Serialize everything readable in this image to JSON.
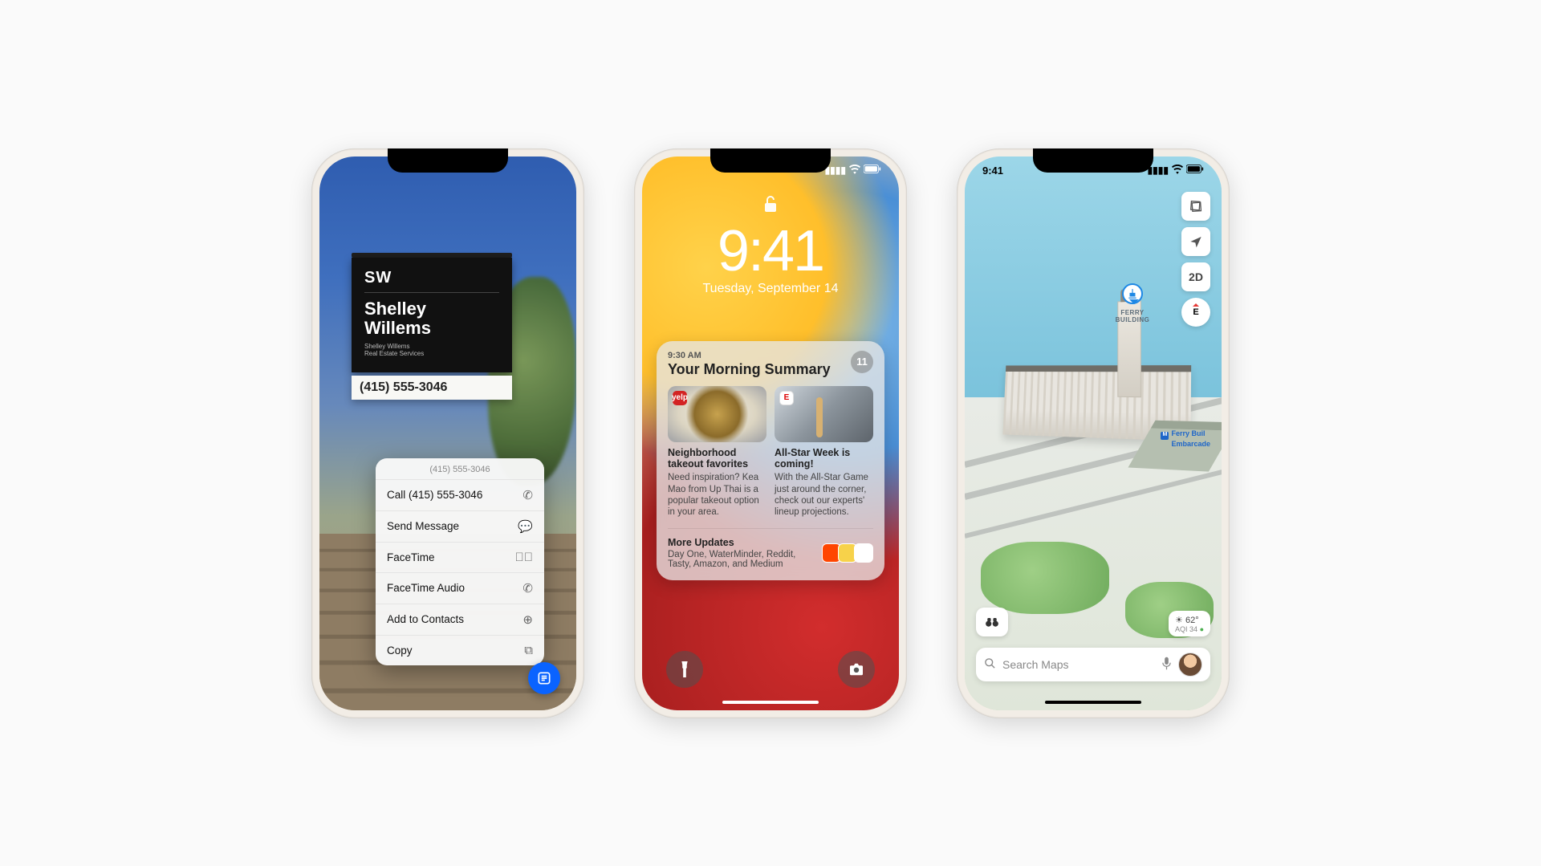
{
  "status": {
    "time": "9:41"
  },
  "phone1": {
    "sign": {
      "logo": "SW",
      "name": "Shelley\nWillems",
      "sub": "Shelley Willems\nReal Estate Services",
      "phone": "(415) 555-3046"
    },
    "context_menu": {
      "header_phone": "(415) 555-3046",
      "items": [
        {
          "label": "Call (415) 555-3046",
          "icon": "phone-icon"
        },
        {
          "label": "Send Message",
          "icon": "message-icon"
        },
        {
          "label": "FaceTime",
          "icon": "video-icon"
        },
        {
          "label": "FaceTime Audio",
          "icon": "phone-icon"
        },
        {
          "label": "Add to Contacts",
          "icon": "add-contact-icon"
        },
        {
          "label": "Copy",
          "icon": "copy-icon"
        }
      ]
    }
  },
  "phone2": {
    "lock": {
      "time": "9:41",
      "date": "Tuesday, September 14"
    },
    "summary": {
      "time": "9:30 AM",
      "title": "Your Morning Summary",
      "badge_count": "11",
      "cards": [
        {
          "app": "yelp",
          "headline": "Neighborhood takeout favorites",
          "body": "Need inspiration? Kea Mao from Up Thai is a popular takeout option in your area."
        },
        {
          "app": "E",
          "headline": "All-Star Week is coming!",
          "body": "With the All-Star Game just around the corner, check out our experts' lineup projections."
        }
      ],
      "more": {
        "title": "More Updates",
        "body": "Day One, WaterMinder, Reddit, Tasty, Amazon, and Medium"
      }
    }
  },
  "phone3": {
    "pin_label": "FERRY BUILDING",
    "station": {
      "name": "Ferry Buil",
      "sub": "Embarcade"
    },
    "controls": {
      "mode2d": "2D",
      "compass": "E"
    },
    "weather": {
      "temp": "62°",
      "aqi_label": "AQI 34"
    },
    "search": {
      "placeholder": "Search Maps"
    }
  }
}
